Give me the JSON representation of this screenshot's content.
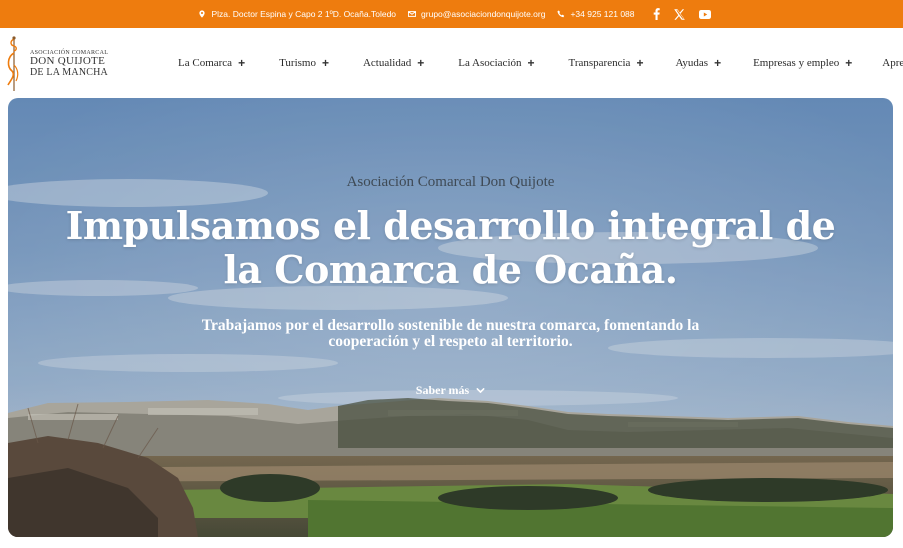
{
  "topbar": {
    "address": "Plza. Doctor Espina y Capo 2 1ºD. Ocaña.Toledo",
    "email": "grupo@asociaciondonquijote.org",
    "phone": "+34 925 121 088",
    "background": "#ee7c0e"
  },
  "logo": {
    "line1": "Asociación Comarcal",
    "line2": "DON QUIJOTE",
    "line3": "DE LA MANCHA"
  },
  "nav": {
    "items": [
      {
        "label": "La Comarca",
        "has_submenu": true
      },
      {
        "label": "Turismo",
        "has_submenu": true
      },
      {
        "label": "Actualidad",
        "has_submenu": true
      },
      {
        "label": "La Asociación",
        "has_submenu": true
      },
      {
        "label": "Transparencia",
        "has_submenu": true
      },
      {
        "label": "Ayudas",
        "has_submenu": true
      },
      {
        "label": "Empresas y empleo",
        "has_submenu": true
      },
      {
        "label": "Aprende IA",
        "has_submenu": false
      }
    ]
  },
  "hero": {
    "eyebrow": "Asociación Comarcal Don Quijote",
    "headline": "Impulsamos el desarrollo integral de la Comarca de Ocaña.",
    "subline": "Trabajamos por el desarrollo sostenible de nuestra comarca, fomentando la cooperación y el respeto al territorio.",
    "cta_label": "Saber más"
  },
  "icons": {
    "address": "map-pin-icon",
    "email": "envelope-icon",
    "phone": "phone-icon",
    "social": [
      "facebook-icon",
      "x-twitter-icon",
      "youtube-icon"
    ]
  }
}
